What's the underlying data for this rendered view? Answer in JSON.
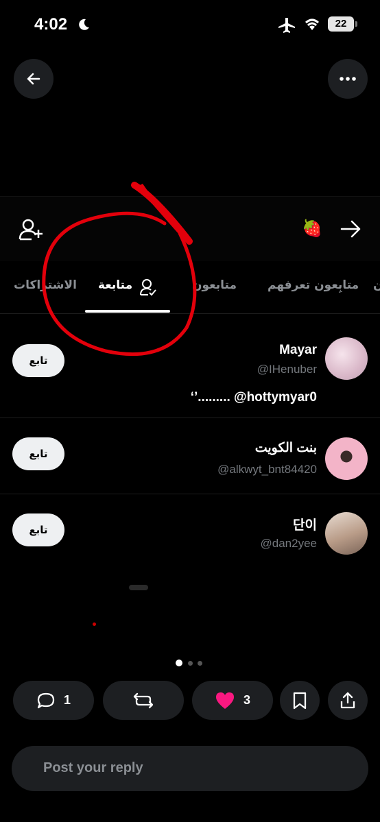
{
  "status": {
    "time": "4:02",
    "battery": "22"
  },
  "icons": {
    "back": "arrow-left-icon",
    "more": "more-horizontal-icon",
    "add_user": "add-user-icon",
    "forward": "arrow-right-icon",
    "strawberry": "🍓"
  },
  "tabs": [
    {
      "label": "ن"
    },
    {
      "label": "متابِعون تعرفهم"
    },
    {
      "label": "متابعون"
    },
    {
      "label": "متابعة",
      "active": true
    },
    {
      "label": "الاشتراكات"
    }
  ],
  "users": [
    {
      "name": "Mayar",
      "handle": "@IHenuber",
      "bio": "‘’......... @hottymyar0",
      "follow_label": "تابع"
    },
    {
      "name": "بنت الكويت",
      "handle": "@alkwyt_bnt84420",
      "follow_label": "تابع"
    },
    {
      "name": "단이",
      "handle": "@dan2yee",
      "follow_label": "تابع"
    }
  ],
  "actions": {
    "reply_count": "1",
    "like_count": "3",
    "like_color": "#f91880"
  },
  "reply": {
    "placeholder": "Post your reply"
  }
}
